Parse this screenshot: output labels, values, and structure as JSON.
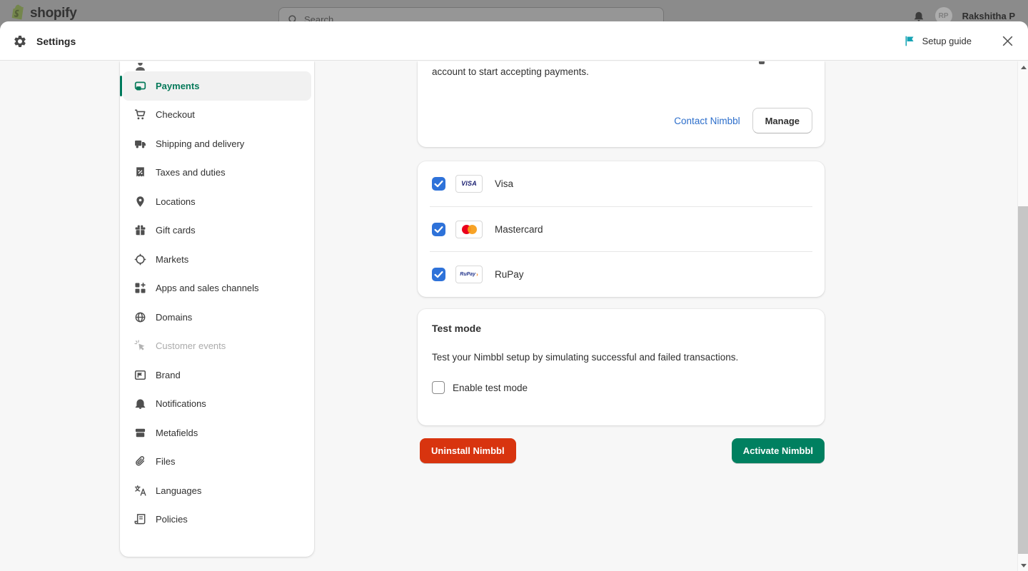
{
  "topbar": {
    "brand": "shopify",
    "search_placeholder": "Search",
    "user_initials": "RP",
    "user_name": "Rakshitha P"
  },
  "modal_header": {
    "title": "Settings",
    "setup_guide_label": "Setup guide"
  },
  "sidebar": {
    "items": [
      {
        "label": "Payments",
        "state": "selected"
      },
      {
        "label": "Checkout",
        "state": "normal"
      },
      {
        "label": "Shipping and delivery",
        "state": "normal"
      },
      {
        "label": "Taxes and duties",
        "state": "normal"
      },
      {
        "label": "Locations",
        "state": "normal"
      },
      {
        "label": "Gift cards",
        "state": "normal"
      },
      {
        "label": "Markets",
        "state": "normal"
      },
      {
        "label": "Apps and sales channels",
        "state": "normal"
      },
      {
        "label": "Domains",
        "state": "normal"
      },
      {
        "label": "Customer events",
        "state": "disabled"
      },
      {
        "label": "Brand",
        "state": "normal"
      },
      {
        "label": "Notifications",
        "state": "normal"
      },
      {
        "label": "Metafields",
        "state": "normal"
      },
      {
        "label": "Files",
        "state": "normal"
      },
      {
        "label": "Languages",
        "state": "normal"
      },
      {
        "label": "Policies",
        "state": "normal"
      }
    ]
  },
  "main": {
    "provider_card": {
      "clipped_text": "account to start accepting payments.",
      "contact_link": "Contact Nimbbl",
      "manage_button": "Manage"
    },
    "payment_methods": [
      {
        "label": "Visa",
        "badge": "VISA",
        "checked": true
      },
      {
        "label": "Mastercard",
        "badge": "mastercard-circles",
        "checked": true
      },
      {
        "label": "RuPay",
        "badge": "RuPay",
        "checked": true
      }
    ],
    "test_mode": {
      "title": "Test mode",
      "description": "Test your Nimbbl setup by simulating successful and failed transactions.",
      "checkbox_label": "Enable test mode",
      "checked": false
    },
    "actions": {
      "uninstall_button": "Uninstall Nimbbl",
      "activate_button": "Activate Nimbbl"
    }
  },
  "colors": {
    "accent_green": "#008060",
    "selected_green": "#067a5a",
    "critical_red": "#d8340f",
    "link_blue": "#2c6ecb",
    "checkbox_blue": "#2e72d9",
    "setup_flag_teal": "#14a3b4"
  }
}
